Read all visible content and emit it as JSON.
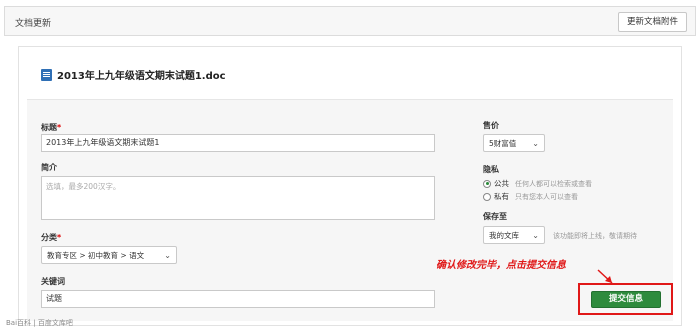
{
  "header": {
    "title": "文档更新",
    "update_attachment_button": "更新文档附件"
  },
  "file": {
    "name": "2013年上九年级语文期末试题1.doc",
    "icon": "doc-icon"
  },
  "form": {
    "title_label": "标题",
    "title_required": "*",
    "title_value": "2013年上九年级语文期末试题1",
    "summary_label": "简介",
    "summary_placeholder": "选填，最多200汉字。",
    "category_label": "分类",
    "category_required": "*",
    "category_value": "教育专区 > 初中教育 > 语文",
    "keywords_label": "关键词",
    "keywords_value": "试题",
    "price_label": "售价",
    "price_value": "5财富值",
    "privacy_label": "隐私",
    "privacy_public": "公共",
    "privacy_public_desc": "任何人都可以检索或查看",
    "privacy_private": "私有",
    "privacy_private_desc": "只有您本人可以查看",
    "privacy_selected": "公共",
    "save_to_label": "保存至",
    "save_to_value": "我的文库",
    "save_to_hint": "该功能即将上线，敬请期待"
  },
  "annotation": {
    "text": "确认修改完毕，点击提交信息",
    "color": "#e01818"
  },
  "submit_button": "提交信息",
  "watermark": "Bai百科 | 百度文库吧",
  "colors": {
    "accent_green": "#2e8b3d",
    "required_red": "#dd0000"
  }
}
